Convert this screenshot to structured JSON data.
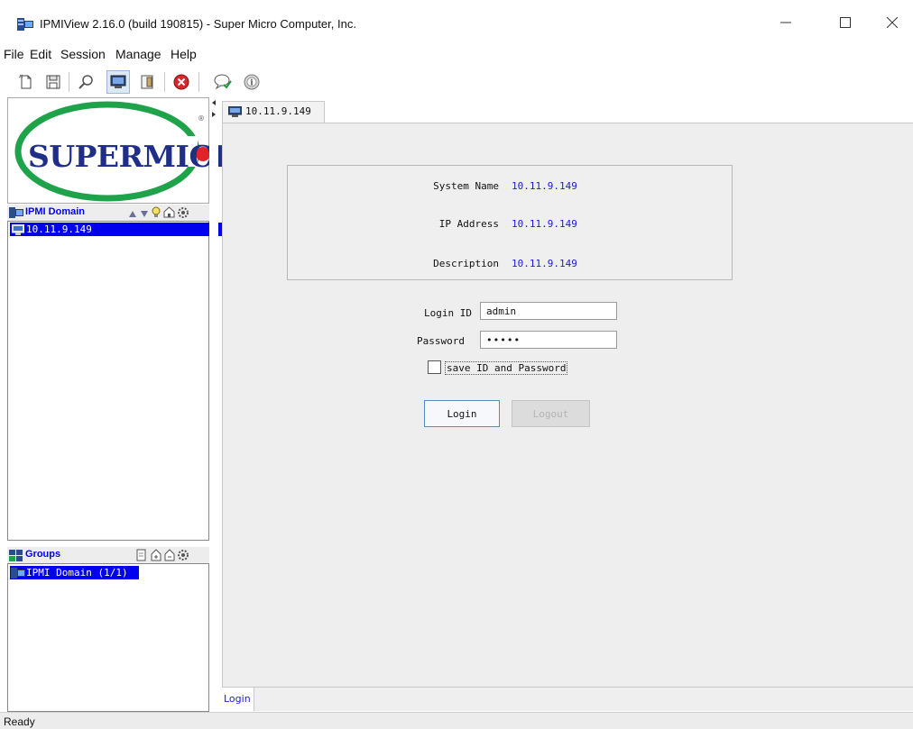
{
  "window": {
    "title": "IPMIView 2.16.0 (build 190815) - Super Micro Computer, Inc."
  },
  "menu": [
    "File",
    "Edit",
    "Session",
    "Manage",
    "Help"
  ],
  "toolbar": {
    "icons": [
      "new-file-icon",
      "save-icon",
      "search-icon",
      "monitor-icon",
      "window-icon",
      "stop-icon",
      "chat-check-icon",
      "info-icon"
    ]
  },
  "logo": {
    "text": "SUPERMICR",
    "registered": "®"
  },
  "ipmi_domain": {
    "title": "IPMI Domain",
    "items": [
      "10.11.9.149"
    ]
  },
  "groups": {
    "title": "Groups",
    "items": [
      "IPMI Domain (1/1)"
    ]
  },
  "tab": {
    "label": "10.11.9.149"
  },
  "info": {
    "system_name_label": "System Name",
    "system_name": "10.11.9.149",
    "ip_address_label": "IP Address",
    "ip_address": "10.11.9.149",
    "description_label": "Description",
    "description": "10.11.9.149"
  },
  "login_form": {
    "login_id_label": "Login ID",
    "login_id": "admin",
    "password_label": "Password",
    "password": "•••••",
    "save_label": "save ID and Password",
    "save_checked": false,
    "login_button": "Login",
    "logout_button": "Logout"
  },
  "bottom_tab": "Login",
  "status": "Ready",
  "colors": {
    "selection": "#0000ee",
    "link_blue": "#1a1ad6",
    "logo_blue": "#1f2e86",
    "logo_green": "#1fa34a",
    "logo_red": "#e0222a"
  }
}
